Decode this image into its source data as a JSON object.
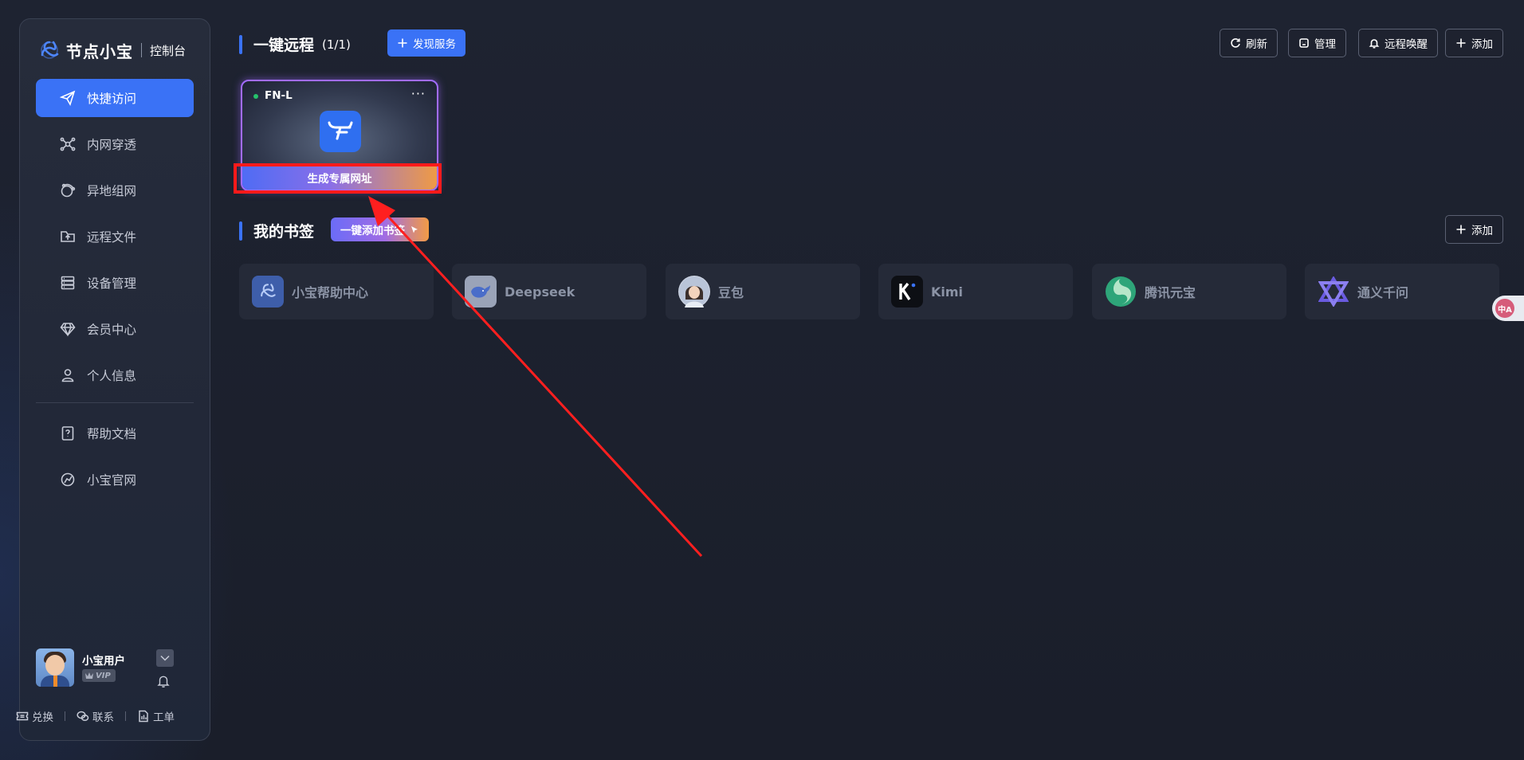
{
  "brand": {
    "name": "节点小宝",
    "subtitle": "控制台"
  },
  "sidebar": {
    "items": [
      {
        "label": "快捷访问",
        "icon": "send-icon",
        "active": true
      },
      {
        "label": "内网穿透",
        "icon": "network-nodes-icon"
      },
      {
        "label": "异地组网",
        "icon": "globe-link-icon"
      },
      {
        "label": "远程文件",
        "icon": "folder-upload-icon"
      },
      {
        "label": "设备管理",
        "icon": "server-icon"
      },
      {
        "label": "会员中心",
        "icon": "diamond-icon"
      },
      {
        "label": "个人信息",
        "icon": "user-icon"
      }
    ],
    "secondary_items": [
      {
        "label": "帮助文档",
        "icon": "help-doc-icon"
      },
      {
        "label": "小宝官网",
        "icon": "website-icon"
      }
    ],
    "user": {
      "name": "小宝用户",
      "badge": "VIP"
    },
    "footer": {
      "redeem": "兑换",
      "contact": "联系",
      "ticket": "工单"
    }
  },
  "remote": {
    "title": "一键远程",
    "count": "(1/1)",
    "discover_label": "发现服务",
    "toolbar": {
      "refresh": "刷新",
      "manage": "管理",
      "wake": "远程唤醒",
      "add": "添加"
    },
    "device": {
      "name": "FN-L",
      "more": "···",
      "status": "online",
      "action_label": "生成专属网址"
    }
  },
  "bookmarks": {
    "title": "我的书签",
    "quick_add_label": "一键添加书签",
    "add_label": "添加",
    "items": [
      {
        "label": "小宝帮助中心",
        "icon": "xiaobao-logo-icon"
      },
      {
        "label": "Deepseek",
        "icon": "deepseek-whale-icon"
      },
      {
        "label": "豆包",
        "icon": "doubao-avatar-icon"
      },
      {
        "label": "Kimi",
        "icon": "kimi-k-icon"
      },
      {
        "label": "腾讯元宝",
        "icon": "yuanbao-icon"
      },
      {
        "label": "通义千问",
        "icon": "tongyi-icon"
      }
    ]
  },
  "translate_fab": "中A",
  "colors": {
    "accent": "#3a72f6",
    "highlight": "#ff1a1a",
    "online": "#25c26b"
  }
}
